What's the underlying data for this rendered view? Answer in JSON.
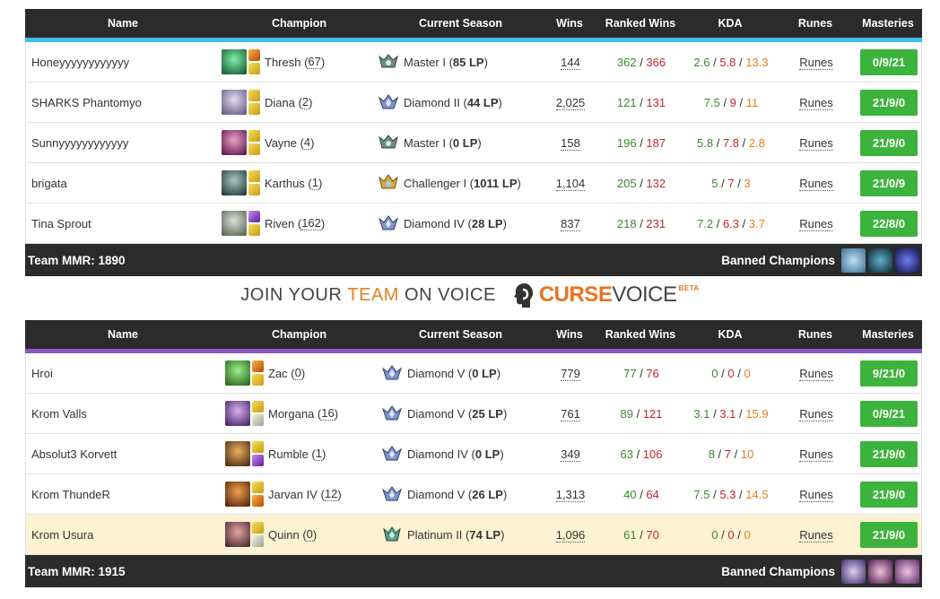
{
  "headers": {
    "name": "Name",
    "champion": "Champion",
    "season": "Current Season",
    "wins": "Wins",
    "ranked_wins": "Ranked Wins",
    "kda": "KDA",
    "runes": "Runes",
    "masteries": "Masteries"
  },
  "colors": {
    "blue_team": "#41bde8",
    "purple_team": "#8a58c5",
    "mastery_button": "#3cb33c",
    "kda_green": "#3a8a2e",
    "kda_red": "#c0272d",
    "kda_orange": "#e67e22",
    "highlight_row": "#fdf2d2"
  },
  "team1": {
    "mmr_label": "Team MMR: 1890",
    "banned_label": "Banned Champions",
    "players": [
      {
        "name": "Honeyyyyyyyyyyyy",
        "champion": "Thresh",
        "level": "67",
        "rank": "Master I",
        "lp": "85 LP",
        "wins": "144",
        "rw": "362",
        "rl": "366",
        "k": "2.6",
        "d": "5.8",
        "a": "13.3",
        "runes": "Runes",
        "masteries": "0/9/21"
      },
      {
        "name": "SHARKS Phantomyo",
        "champion": "Diana",
        "level": "2",
        "rank": "Diamond II",
        "lp": "44 LP",
        "wins": "2,025",
        "rw": "121",
        "rl": "131",
        "k": "7.5",
        "d": "9",
        "a": "11",
        "runes": "Runes",
        "masteries": "21/9/0"
      },
      {
        "name": "Sunnyyyyyyyyyyyy",
        "champion": "Vayne",
        "level": "4",
        "rank": "Master I",
        "lp": "0 LP",
        "wins": "158",
        "rw": "196",
        "rl": "187",
        "k": "5.8",
        "d": "7.8",
        "a": "2.8",
        "runes": "Runes",
        "masteries": "21/9/0"
      },
      {
        "name": "brigata",
        "champion": "Karthus",
        "level": "1",
        "rank": "Challenger I",
        "lp": "1011 LP",
        "wins": "1,104",
        "rw": "205",
        "rl": "132",
        "k": "5",
        "d": "7",
        "a": "3",
        "runes": "Runes",
        "masteries": "21/0/9"
      },
      {
        "name": "Tina Sprout",
        "champion": "Riven",
        "level": "162",
        "rank": "Diamond IV",
        "lp": "28 LP",
        "wins": "837",
        "rw": "218",
        "rl": "231",
        "k": "7.2",
        "d": "6.3",
        "a": "3.7",
        "runes": "Runes",
        "masteries": "22/8/0"
      }
    ]
  },
  "voice_banner": {
    "join": "JOIN YOUR",
    "team": "TEAM",
    "on_voice": "ON VOICE",
    "curse": "CURSE",
    "voice": "VOICE",
    "beta": "BETA"
  },
  "team2": {
    "mmr_label": "Team MMR: 1915",
    "banned_label": "Banned Champions",
    "players": [
      {
        "name": "Hroi",
        "champion": "Zac",
        "level": "0",
        "rank": "Diamond V",
        "lp": "0 LP",
        "wins": "779",
        "rw": "77",
        "rl": "76",
        "k": "0",
        "d": "0",
        "a": "0",
        "runes": "Runes",
        "masteries": "9/21/0"
      },
      {
        "name": "Krom Valls",
        "champion": "Morgana",
        "level": "16",
        "rank": "Diamond V",
        "lp": "25 LP",
        "wins": "761",
        "rw": "89",
        "rl": "121",
        "k": "3.1",
        "d": "3.1",
        "a": "15.9",
        "runes": "Runes",
        "masteries": "0/9/21"
      },
      {
        "name": "Absolut3 Korvett",
        "champion": "Rumble",
        "level": "1",
        "rank": "Diamond IV",
        "lp": "0 LP",
        "wins": "349",
        "rw": "63",
        "rl": "106",
        "k": "8",
        "d": "7",
        "a": "10",
        "runes": "Runes",
        "masteries": "21/9/0"
      },
      {
        "name": "Krom ThundeR",
        "champion": "Jarvan IV",
        "level": "12",
        "rank": "Diamond V",
        "lp": "26 LP",
        "wins": "1,313",
        "rw": "40",
        "rl": "64",
        "k": "7.5",
        "d": "5.3",
        "a": "14.5",
        "runes": "Runes",
        "masteries": "21/9/0"
      },
      {
        "name": "Krom Usura",
        "champion": "Quinn",
        "level": "0",
        "rank": "Platinum II",
        "lp": "74 LP",
        "wins": "1,096",
        "rw": "61",
        "rl": "70",
        "k": "0",
        "d": "0",
        "a": "0",
        "runes": "Runes",
        "masteries": "21/9/0"
      }
    ]
  }
}
